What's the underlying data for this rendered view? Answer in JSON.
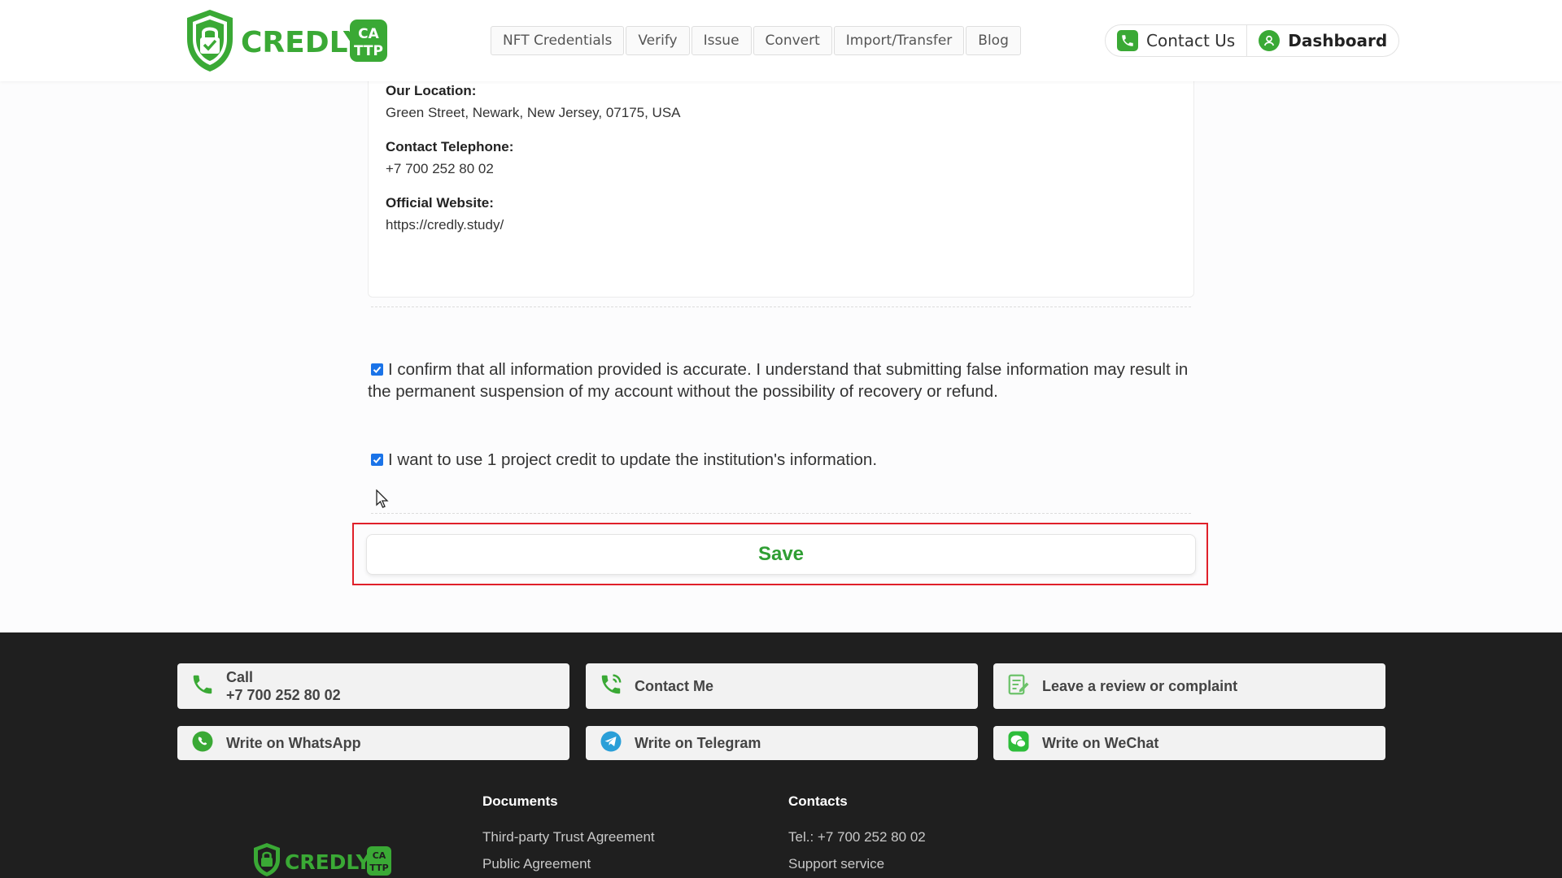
{
  "brand": {
    "logo_text": "CREDLY",
    "logo_badge_top": "CA",
    "logo_badge_bottom": "TTP",
    "color_green": "#3aa935"
  },
  "nav": {
    "items": [
      "NFT Credentials",
      "Verify",
      "Issue",
      "Convert",
      "Import/Transfer",
      "Blog"
    ]
  },
  "header_actions": {
    "contact_label": "Contact Us",
    "dashboard_label": "Dashboard"
  },
  "info": {
    "location_label": "Our Location:",
    "location_value": "Green Street, Newark, New Jersey, 07175, USA",
    "telephone_label": "Contact Telephone:",
    "telephone_value": "+7 700 252 80 02",
    "website_label": "Official Website:",
    "website_value": "https://credly.study/"
  },
  "confirmations": {
    "accuracy_checked": true,
    "accuracy_text": "I confirm that all information provided is accurate. I understand that submitting false information may result in the permanent suspension of my account without the possibility of recovery or refund.",
    "credit_checked": true,
    "credit_text": "I want to use 1 project credit to update the institution's information."
  },
  "save": {
    "label": "Save",
    "highlight_color": "#e0202a"
  },
  "footer": {
    "call_label": "Call",
    "call_number": "+7 700 252 80 02",
    "contact_me": "Contact Me",
    "review": "Leave a review or complaint",
    "whatsapp": "Write on WhatsApp",
    "telegram": "Write on Telegram",
    "wechat": "Write on WeChat",
    "documents_title": "Documents",
    "documents": [
      "Third-party Trust Agreement",
      "Public Agreement"
    ],
    "contacts_title": "Contacts",
    "contacts": [
      "Tel.: +7 700 252 80 02",
      "Support service"
    ]
  }
}
